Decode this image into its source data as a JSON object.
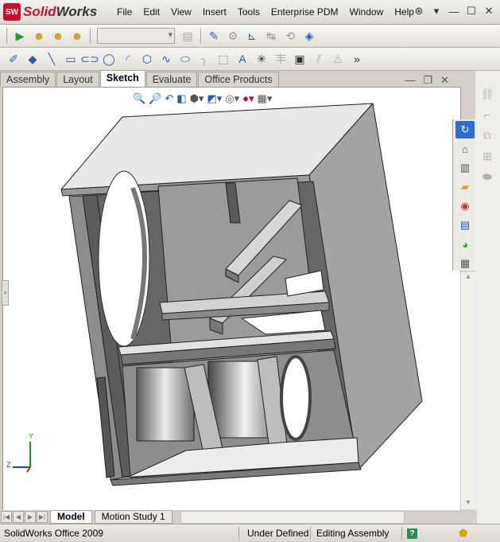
{
  "app": {
    "logo_letters": "SW",
    "name_part1": "Solid",
    "name_part2": "Works"
  },
  "menu": [
    "File",
    "Edit",
    "View",
    "Insert",
    "Tools",
    "Enterprise PDM",
    "Window",
    "Help"
  ],
  "window_controls": {
    "pin": "⊛",
    "dropdown": "▾",
    "minimize": "—",
    "maximize": "☐",
    "close": "✕"
  },
  "toolbar1": {
    "icons": [
      {
        "name": "run-icon",
        "glyph": "▶",
        "color": "#1e9a1e"
      },
      {
        "name": "user1-icon",
        "glyph": "👤",
        "color": "#c89b1e"
      },
      {
        "name": "user2-icon",
        "glyph": "👤",
        "color": "#c89b1e"
      },
      {
        "name": "user3-icon",
        "glyph": "👤",
        "color": "#c89b1e"
      }
    ],
    "combo_value": ""
  },
  "tabs": [
    "Assembly",
    "Layout",
    "Sketch",
    "Evaluate",
    "Office Products"
  ],
  "active_tab": "Sketch",
  "viewport_controls": {
    "minimize": "—",
    "restore": "❐",
    "close": "✕"
  },
  "headsup_icons": [
    "zoom-to-fit",
    "zoom-area",
    "previous-view",
    "section-view",
    "view-orientation",
    "display-style",
    "hide-show",
    "edit-appearance",
    "apply-scene"
  ],
  "triad": {
    "x_label": "Z",
    "y_label": "Y"
  },
  "bottom_tabs": [
    "Model",
    "Motion Study 1"
  ],
  "active_bottom_tab": "Model",
  "status": {
    "product": "SolidWorks Office 2009",
    "definition": "Under Defined",
    "mode": "Editing Assembly",
    "help": "?"
  }
}
